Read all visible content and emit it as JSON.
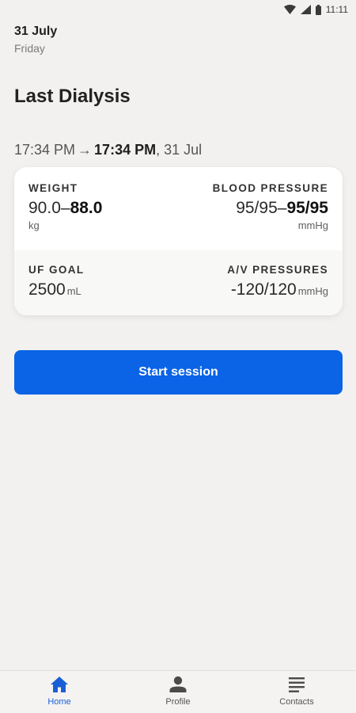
{
  "status_bar": {
    "time": "11:11"
  },
  "header": {
    "date": "31 July",
    "weekday": "Friday"
  },
  "section": {
    "title": "Last Dialysis"
  },
  "session": {
    "start_time": "17:34 PM",
    "arrow": "→",
    "end_time": "17:34 PM",
    "end_date": ", 31 Jul"
  },
  "card": {
    "weight": {
      "label": "WEIGHT",
      "pre": "90.0–",
      "post": "88.0",
      "unit": "kg"
    },
    "blood_pressure": {
      "label": "BLOOD PRESSURE",
      "pre": "95/95–",
      "post": "95/95",
      "unit": "mmHg"
    },
    "uf_goal": {
      "label": "UF GOAL",
      "value": "2500",
      "unit": "mL"
    },
    "av_pressures": {
      "label": "A/V PRESSURES",
      "value": "-120/120",
      "unit": "mmHg"
    }
  },
  "actions": {
    "start_session": "Start session"
  },
  "nav": {
    "items": [
      {
        "label": "Home",
        "icon": "home-icon",
        "active": true
      },
      {
        "label": "Profile",
        "icon": "person-icon",
        "active": false
      },
      {
        "label": "Contacts",
        "icon": "list-icon",
        "active": false
      }
    ]
  },
  "colors": {
    "accent": "#0b63e5",
    "nav_active": "#1a5fd6",
    "background": "#f2f1ef"
  }
}
